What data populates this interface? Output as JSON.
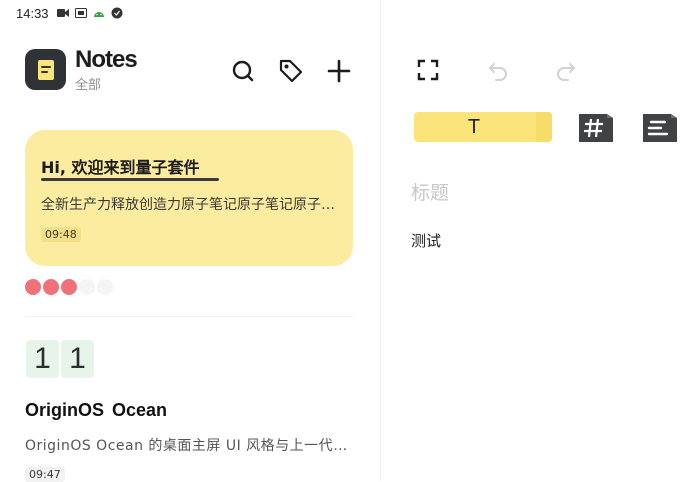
{
  "status_bar": {
    "time": "14:33",
    "icons": [
      "video-icon",
      "sim-icon",
      "android-icon",
      "vpn-icon"
    ]
  },
  "header": {
    "title": "Notes",
    "subtitle": "全部",
    "icons": [
      "search-icon",
      "tag-icon",
      "add-icon"
    ]
  },
  "notes": [
    {
      "title": "Hi, 欢迎来到量子套件",
      "preview": "全新生产力释放创造力原子笔记原子笔记原子笔记",
      "time": "09:48",
      "color": "#fcec9f"
    },
    {
      "date_digits": [
        "1",
        "1"
      ],
      "title": "OriginOS Ocean",
      "preview": "OriginOS Ocean 的桌面主屏 UI 风格与上一代系统相比",
      "time": "09:47"
    }
  ],
  "tag_dots": [
    "#f0717a",
    "#f0717a",
    "#f0717a",
    "#d9d9d9",
    "#d9d9d9"
  ],
  "editor": {
    "toolbar_icons": [
      "fullscreen-icon",
      "undo-icon",
      "redo-icon"
    ],
    "style_options": {
      "text_label": "T",
      "text_color": "#fbe57a"
    },
    "title_placeholder": "标题",
    "body": "测试"
  }
}
